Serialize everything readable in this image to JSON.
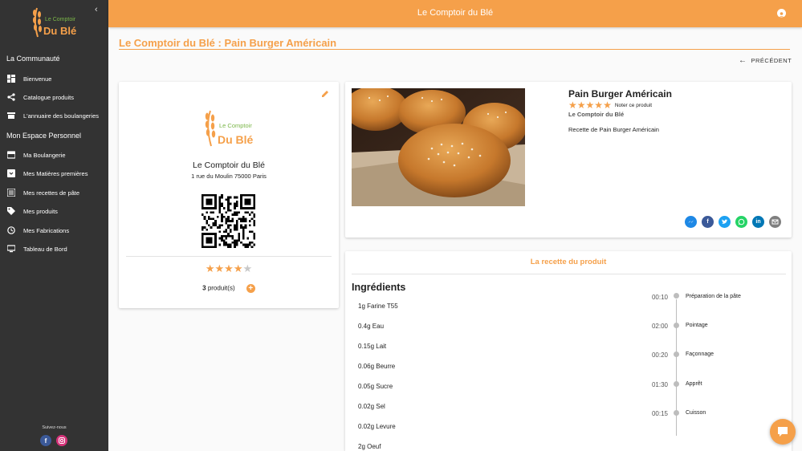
{
  "sidebar": {
    "logo_text_top": "Le Comptoir",
    "logo_text_bottom": "Du Blé",
    "section_community": "La Communauté",
    "community_items": [
      {
        "label": "Bienvenue",
        "icon": "dashboard-icon"
      },
      {
        "label": "Catalogue produits",
        "icon": "share-icon"
      },
      {
        "label": "L'annuaire des boulangeries",
        "icon": "store-icon"
      }
    ],
    "section_personal": "Mon Espace Personnel",
    "personal_items": [
      {
        "label": "Ma Boulangerie",
        "icon": "storefront-icon"
      },
      {
        "label": "Mes Matières premières",
        "icon": "inbox-icon"
      },
      {
        "label": "Mes recettes de pâte",
        "icon": "list-icon"
      },
      {
        "label": "Mes produits",
        "icon": "tag-icon"
      },
      {
        "label": "Mes Fabrications",
        "icon": "clock-icon"
      },
      {
        "label": "Tableau de Bord",
        "icon": "monitor-icon"
      }
    ],
    "follow_label": "Suivez-nous"
  },
  "topbar": {
    "title": "Le Comptoir du Blé"
  },
  "page": {
    "title": "Le Comptoir du Blé : Pain Burger Américain",
    "back_label": "PRÉCÉDENT"
  },
  "bakery_card": {
    "name": "Le Comptoir du Blé",
    "address": "1 rue du Moulin 75000 Paris",
    "rating": 4,
    "rating_max": 5,
    "product_count": "3",
    "product_count_suffix": " produit(s)"
  },
  "product": {
    "title": "Pain Burger Américain",
    "rating": 5,
    "rate_label": "Noter ce produit",
    "brand": "Le Comptoir du Blé",
    "description": "Recette de Pain Burger Américain"
  },
  "recipe": {
    "heading": "La recette du produit",
    "ingredients_title": "Ingrédients",
    "ingredients": [
      "1g Farine T55",
      "0.4g Eau",
      "0.15g Lait",
      "0.06g Beurre",
      "0.05g Sucre",
      "0.02g Sel",
      "0.02g Levure",
      "2g Oeuf"
    ],
    "timeline": [
      {
        "time": "00:10",
        "label": "Préparation de la pâte"
      },
      {
        "time": "02:00",
        "label": "Pointage"
      },
      {
        "time": "00:20",
        "label": "Façonnage"
      },
      {
        "time": "01:30",
        "label": "Apprêt"
      },
      {
        "time": "00:15",
        "label": "Cuisson"
      }
    ]
  },
  "colors": {
    "accent": "#f5a04a",
    "sidebar": "#333333"
  }
}
